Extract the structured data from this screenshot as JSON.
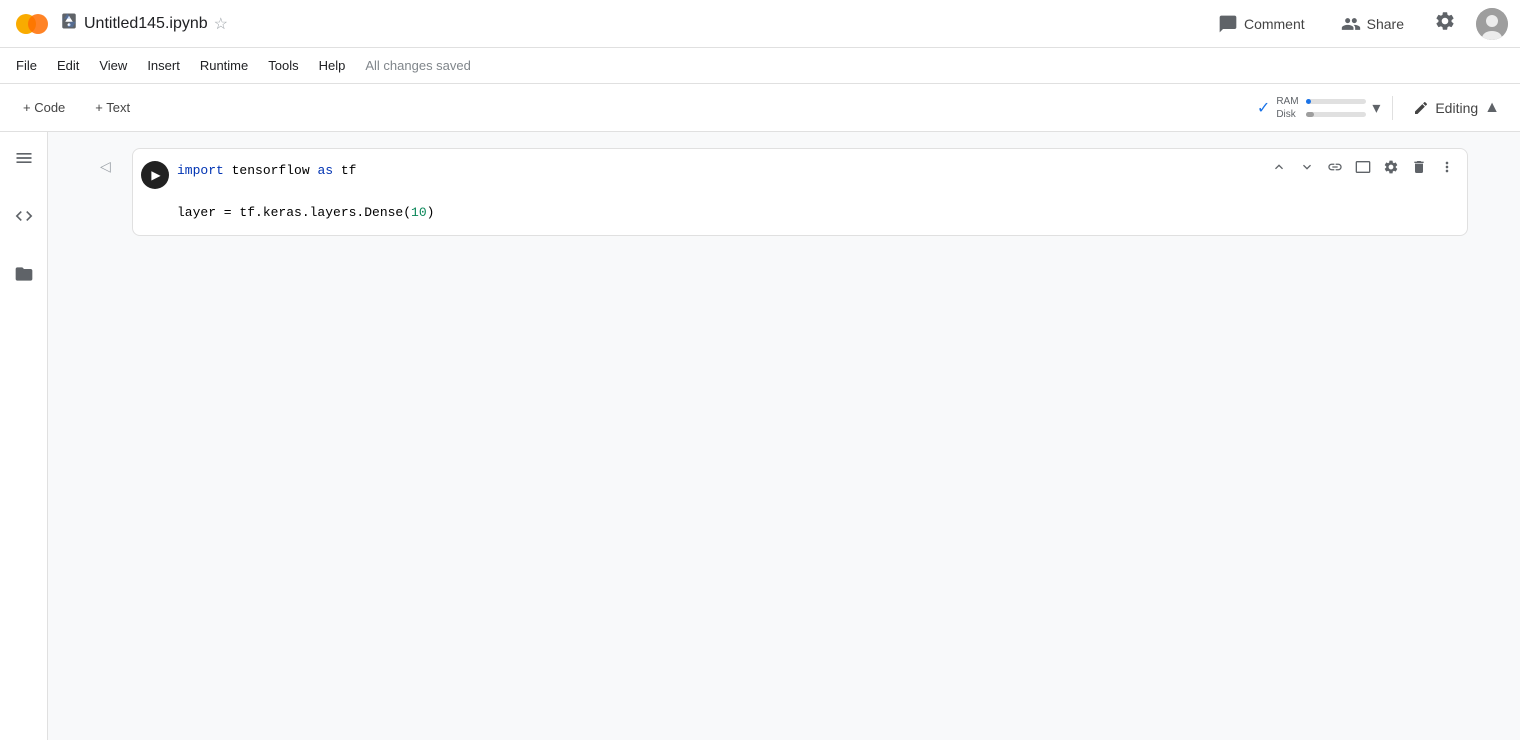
{
  "header": {
    "logo_text": "CO",
    "drive_icon": "📄",
    "file_name": "Untitled145.ipynb",
    "star_icon": "☆",
    "comment_label": "Comment",
    "share_label": "Share",
    "all_changes_saved": "All changes saved",
    "status_label": "Editing",
    "ram_label": "RAM",
    "disk_label": "Disk",
    "ram_pct": 8,
    "disk_pct": 12
  },
  "menu": {
    "items": [
      "File",
      "Edit",
      "View",
      "Insert",
      "Runtime",
      "Tools",
      "Help"
    ]
  },
  "toolbar": {
    "add_code_label": "+ Code",
    "add_text_label": "+ Text"
  },
  "sidebar": {
    "icons": [
      "≡",
      "◁▷",
      "□"
    ]
  },
  "cell": {
    "code_lines": [
      "import tensorflow as tf",
      "",
      "layer = tf.keras.layers.Dense(10)"
    ],
    "toolbar_icons": [
      "↑",
      "↓",
      "🔗",
      "□",
      "⚙",
      "🗑",
      "⋮"
    ]
  }
}
